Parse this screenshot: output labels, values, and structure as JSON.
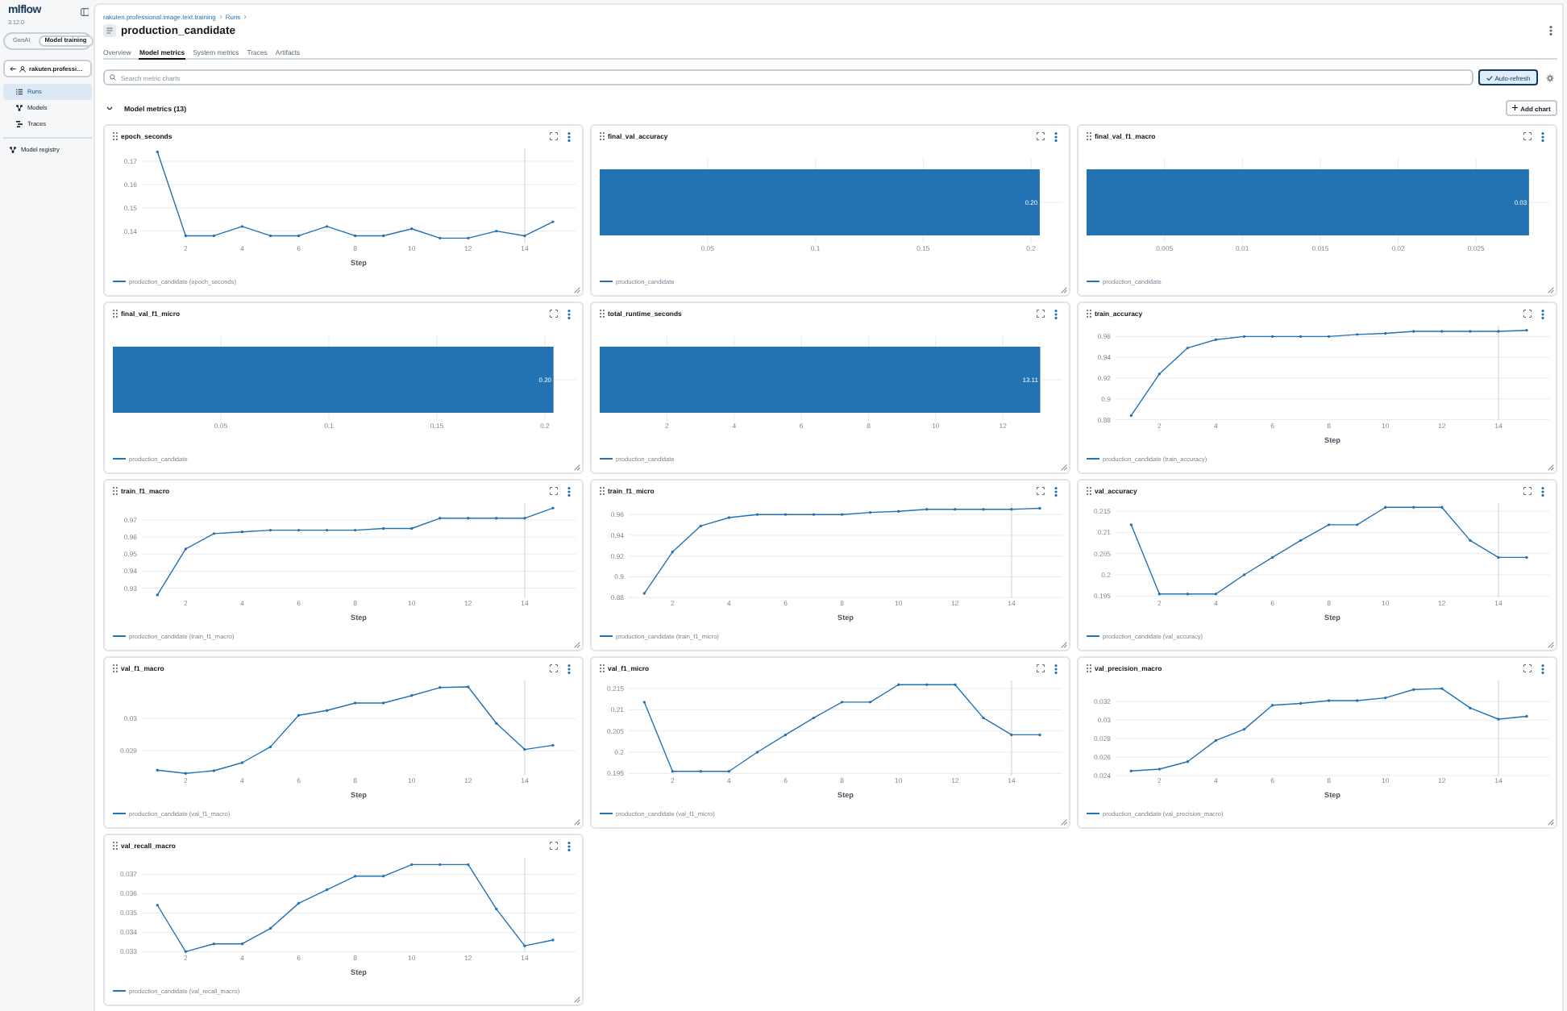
{
  "sidebar": {
    "logo": "mlflow",
    "version": "3.12.0",
    "mode_switch": [
      {
        "label": "GenAI",
        "selected": false
      },
      {
        "label": "Model training",
        "selected": true
      }
    ],
    "back_link": "rakuten.professi…",
    "nav": [
      {
        "label": "Runs",
        "selected": true
      },
      {
        "label": "Models",
        "selected": false
      },
      {
        "label": "Traces",
        "selected": false
      }
    ],
    "registry_nav": [
      {
        "label": "Model registry",
        "selected": false
      }
    ]
  },
  "header": {
    "breadcrumb": [
      "rakuten.professional.image.text.training",
      "Runs"
    ],
    "title": "production_candidate"
  },
  "tabs": [
    {
      "label": "Overview",
      "selected": false
    },
    {
      "label": "Model metrics",
      "selected": true
    },
    {
      "label": "System metrics",
      "selected": false
    },
    {
      "label": "Traces",
      "selected": false
    },
    {
      "label": "Artifacts",
      "selected": false
    }
  ],
  "search": {
    "placeholder": "Search metric charts"
  },
  "auto_refresh": {
    "label": "Auto-refresh",
    "on": true
  },
  "section": {
    "title": "Model metrics (13)",
    "expanded": true,
    "add_button": "Add chart"
  },
  "charts": [
    {
      "title": "epoch_seconds",
      "chart_data": {
        "type": "line",
        "xlabel": "Step",
        "grid": true,
        "x": [
          1,
          2,
          3,
          4,
          5,
          6,
          7,
          8,
          9,
          10,
          11,
          12,
          13,
          14,
          15
        ],
        "xlim": [
          0.45,
          15.8
        ],
        "ylim": [
          0.1347,
          0.1755
        ],
        "xticks": [
          2,
          4,
          6,
          8,
          10,
          12,
          14
        ],
        "yticks": [
          0.14,
          0.15,
          0.16,
          0.17
        ],
        "ref_lines": [
          {
            "axis": "x",
            "value": 14
          }
        ],
        "series": [
          {
            "name": "production_candidate (epoch_seconds)",
            "color": "#2272b4",
            "values": [
              0.174,
              0.138,
              0.138,
              0.142,
              0.138,
              0.138,
              0.142,
              0.138,
              0.138,
              0.141,
              0.137,
              0.137,
              0.14,
              0.138,
              0.144
            ]
          }
        ]
      }
    },
    {
      "title": "final_val_accuracy",
      "chart_data": {
        "type": "bar",
        "orientation": "horizontal",
        "grid": true,
        "xlim": [
          0,
          0.2145
        ],
        "xticks": [
          0.05,
          0.1,
          0.15,
          0.2
        ],
        "series": [
          {
            "name": "production_candidate",
            "color": "#2272b4",
            "values": [
              0.204
            ]
          }
        ],
        "value_labels": [
          "0.20"
        ]
      }
    },
    {
      "title": "final_val_f1_macro",
      "chart_data": {
        "type": "bar",
        "orientation": "horizontal",
        "grid": true,
        "xlim": [
          0,
          0.0297
        ],
        "xticks": [
          0.005,
          0.01,
          0.015,
          0.02,
          0.025
        ],
        "series": [
          {
            "name": "production_candidate",
            "color": "#2272b4",
            "values": [
              0.0284
            ]
          }
        ],
        "value_labels": [
          "0.03"
        ]
      }
    },
    {
      "title": "final_val_f1_micro",
      "chart_data": {
        "type": "bar",
        "orientation": "horizontal",
        "grid": true,
        "xlim": [
          0,
          0.2142
        ],
        "xticks": [
          0.05,
          0.1,
          0.15,
          0.2
        ],
        "series": [
          {
            "name": "production_candidate",
            "color": "#2272b4",
            "values": [
              0.204
            ]
          }
        ],
        "value_labels": [
          "0.20"
        ]
      }
    },
    {
      "title": "total_runtime_seconds",
      "chart_data": {
        "type": "bar",
        "orientation": "horizontal",
        "grid": true,
        "xlim": [
          0,
          13.77
        ],
        "xticks": [
          2,
          4,
          6,
          8,
          10,
          12
        ],
        "series": [
          {
            "name": "production_candidate",
            "color": "#2272b4",
            "values": [
              13.11
            ]
          }
        ],
        "value_labels": [
          "13.11"
        ]
      }
    },
    {
      "title": "train_accuracy",
      "chart_data": {
        "type": "line",
        "xlabel": "Step",
        "grid": true,
        "x": [
          1,
          2,
          3,
          4,
          5,
          6,
          7,
          8,
          9,
          10,
          11,
          12,
          13,
          14,
          15
        ],
        "xlim": [
          0.45,
          15.8
        ],
        "ylim": [
          0.8789,
          0.9704
        ],
        "xticks": [
          2,
          4,
          6,
          8,
          10,
          12,
          14
        ],
        "yticks": [
          0.88,
          0.9,
          0.92,
          0.94,
          0.96
        ],
        "ref_lines": [
          {
            "axis": "x",
            "value": 14
          }
        ],
        "series": [
          {
            "name": "production_candidate (train_accuracy)",
            "color": "#2272b4",
            "values": [
              0.884,
              0.924,
              0.949,
              0.957,
              0.96,
              0.96,
              0.96,
              0.96,
              0.962,
              0.963,
              0.965,
              0.965,
              0.965,
              0.965,
              0.966
            ]
          }
        ]
      }
    },
    {
      "title": "train_f1_macro",
      "chart_data": {
        "type": "line",
        "xlabel": "Step",
        "grid": true,
        "x": [
          1,
          2,
          3,
          4,
          5,
          6,
          7,
          8,
          9,
          10,
          11,
          12,
          13,
          14,
          15
        ],
        "xlim": [
          0.45,
          15.8
        ],
        "ylim": [
          0.9241,
          0.9799
        ],
        "xticks": [
          2,
          4,
          6,
          8,
          10,
          12,
          14
        ],
        "yticks": [
          0.93,
          0.94,
          0.95,
          0.96,
          0.97
        ],
        "ref_lines": [
          {
            "axis": "x",
            "value": 14
          }
        ],
        "series": [
          {
            "name": "production_candidate (train_f1_macro)",
            "color": "#2272b4",
            "values": [
              0.926,
              0.953,
              0.962,
              0.963,
              0.964,
              0.964,
              0.964,
              0.964,
              0.965,
              0.965,
              0.971,
              0.971,
              0.971,
              0.971,
              0.977
            ]
          }
        ]
      }
    },
    {
      "title": "train_f1_micro",
      "chart_data": {
        "type": "line",
        "xlabel": "Step",
        "grid": true,
        "x": [
          1,
          2,
          3,
          4,
          5,
          6,
          7,
          8,
          9,
          10,
          11,
          12,
          13,
          14,
          15
        ],
        "xlim": [
          0.45,
          15.8
        ],
        "ylim": [
          0.8794,
          0.971
        ],
        "xticks": [
          2,
          4,
          6,
          8,
          10,
          12,
          14
        ],
        "yticks": [
          0.88,
          0.9,
          0.92,
          0.94,
          0.96
        ],
        "ref_lines": [
          {
            "axis": "x",
            "value": 14
          }
        ],
        "series": [
          {
            "name": "production_candidate (train_f1_micro)",
            "color": "#2272b4",
            "values": [
              0.884,
              0.924,
              0.949,
              0.957,
              0.96,
              0.96,
              0.96,
              0.96,
              0.962,
              0.963,
              0.965,
              0.965,
              0.965,
              0.965,
              0.966
            ]
          }
        ]
      }
    },
    {
      "title": "val_accuracy",
      "chart_data": {
        "type": "line",
        "xlabel": "Step",
        "grid": true,
        "x": [
          1,
          2,
          3,
          4,
          5,
          6,
          7,
          8,
          9,
          10,
          11,
          12,
          13,
          14,
          15
        ],
        "xlim": [
          0.45,
          15.8
        ],
        "ylim": [
          0.1945,
          0.2169
        ],
        "xticks": [
          2,
          4,
          6,
          8,
          10,
          12,
          14
        ],
        "yticks": [
          0.195,
          0.2,
          0.205,
          0.21,
          0.215
        ],
        "ref_lines": [
          {
            "axis": "x",
            "value": 14
          }
        ],
        "series": [
          {
            "name": "production_candidate (val_accuracy)",
            "color": "#2272b4",
            "values": [
              0.2118,
              0.1955,
              0.1955,
              0.1955,
              0.2,
              0.2041,
              0.2081,
              0.2118,
              0.2118,
              0.2159,
              0.2159,
              0.2159,
              0.2081,
              0.2041,
              0.2041
            ]
          }
        ]
      }
    },
    {
      "title": "val_f1_macro",
      "chart_data": {
        "type": "line",
        "xlabel": "Step",
        "grid": true,
        "x": [
          1,
          2,
          3,
          4,
          5,
          6,
          7,
          8,
          9,
          10,
          11,
          12,
          13,
          14,
          15
        ],
        "xlim": [
          0.45,
          15.8
        ],
        "ylim": [
          0.02823,
          0.03118
        ],
        "xticks": [
          2,
          4,
          6,
          8,
          10,
          12,
          14
        ],
        "yticks": [
          0.029,
          0.03
        ],
        "ref_lines": [
          {
            "axis": "x",
            "value": 14
          }
        ],
        "series": [
          {
            "name": "production_candidate (val_f1_macro)",
            "color": "#2272b4",
            "values": [
              0.0284,
              0.0283,
              0.02838,
              0.02863,
              0.02912,
              0.0301,
              0.03025,
              0.03048,
              0.03048,
              0.03071,
              0.03096,
              0.03098,
              0.02985,
              0.02904,
              0.02917
            ]
          }
        ]
      }
    },
    {
      "title": "val_f1_micro",
      "chart_data": {
        "type": "line",
        "xlabel": "Step",
        "grid": true,
        "x": [
          1,
          2,
          3,
          4,
          5,
          6,
          7,
          8,
          9,
          10,
          11,
          12,
          13,
          14,
          15
        ],
        "xlim": [
          0.45,
          15.8
        ],
        "ylim": [
          0.1945,
          0.2169
        ],
        "xticks": [
          2,
          4,
          6,
          8,
          10,
          12,
          14
        ],
        "yticks": [
          0.195,
          0.2,
          0.205,
          0.21,
          0.215
        ],
        "ref_lines": [
          {
            "axis": "x",
            "value": 14
          }
        ],
        "series": [
          {
            "name": "production_candidate (val_f1_micro)",
            "color": "#2272b4",
            "values": [
              0.2118,
              0.1955,
              0.1955,
              0.1955,
              0.2,
              0.2041,
              0.2081,
              0.2118,
              0.2118,
              0.2159,
              0.2159,
              0.2159,
              0.2081,
              0.2041,
              0.2041
            ]
          }
        ]
      }
    },
    {
      "title": "val_precision_macro",
      "chart_data": {
        "type": "line",
        "xlabel": "Step",
        "grid": true,
        "x": [
          1,
          2,
          3,
          4,
          5,
          6,
          7,
          8,
          9,
          10,
          11,
          12,
          13,
          14,
          15
        ],
        "xlim": [
          0.45,
          15.8
        ],
        "ylim": [
          0.024,
          0.03428
        ],
        "xticks": [
          2,
          4,
          6,
          8,
          10,
          12,
          14
        ],
        "yticks": [
          0.024,
          0.026,
          0.028,
          0.03,
          0.032
        ],
        "ref_lines": [
          {
            "axis": "x",
            "value": 14
          }
        ],
        "series": [
          {
            "name": "production_candidate (val_precision_macro)",
            "color": "#2272b4",
            "values": [
              0.0245,
              0.0247,
              0.0255,
              0.0278,
              0.029,
              0.0316,
              0.0318,
              0.0321,
              0.0321,
              0.0324,
              0.0333,
              0.0334,
              0.0313,
              0.0301,
              0.0304
            ]
          }
        ]
      }
    },
    {
      "title": "val_recall_macro",
      "chart_data": {
        "type": "line",
        "xlabel": "Step",
        "grid": true,
        "x": [
          1,
          2,
          3,
          4,
          5,
          6,
          7,
          8,
          9,
          10,
          11,
          12,
          13,
          14,
          15
        ],
        "xlim": [
          0.45,
          15.8
        ],
        "ylim": [
          0.03293,
          0.03785
        ],
        "xticks": [
          2,
          4,
          6,
          8,
          10,
          12,
          14
        ],
        "yticks": [
          0.033,
          0.034,
          0.035,
          0.036,
          0.037
        ],
        "ref_lines": [
          {
            "axis": "x",
            "value": 14
          }
        ],
        "series": [
          {
            "name": "production_candidate (val_recall_macro)",
            "color": "#2272b4",
            "values": [
              0.0354,
              0.033,
              0.0334,
              0.0334,
              0.0342,
              0.0355,
              0.0362,
              0.0369,
              0.0369,
              0.0375,
              0.0375,
              0.0375,
              0.0352,
              0.0333,
              0.0336
            ]
          }
        ]
      }
    }
  ]
}
